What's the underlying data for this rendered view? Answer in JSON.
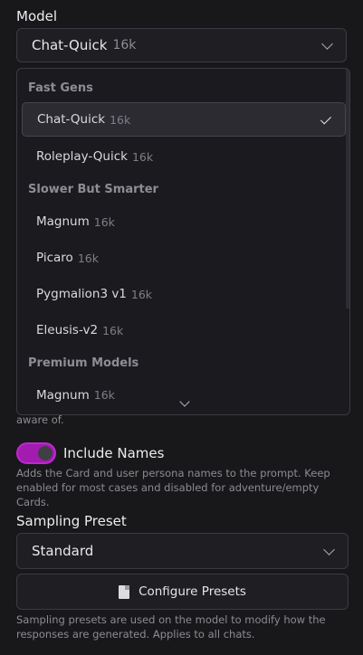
{
  "model": {
    "label": "Model",
    "selected_name": "Chat-Quick",
    "selected_context": "16k"
  },
  "dropdown": {
    "groups": [
      {
        "label": "Fast Gens",
        "options": [
          {
            "name": "Chat-Quick",
            "context": "16k",
            "selected": true
          },
          {
            "name": "Roleplay-Quick",
            "context": "16k",
            "selected": false
          }
        ]
      },
      {
        "label": "Slower But Smarter",
        "options": [
          {
            "name": "Magnum",
            "context": "16k",
            "selected": false
          },
          {
            "name": "Picaro",
            "context": "16k",
            "selected": false
          },
          {
            "name": "Pygmalion3 v1",
            "context": "16k",
            "selected": false
          },
          {
            "name": "Eleusis-v2",
            "context": "16k",
            "selected": false
          }
        ]
      },
      {
        "label": "Premium Models",
        "options": [
          {
            "name": "Magnum",
            "context": "16k",
            "selected": false
          }
        ]
      }
    ]
  },
  "hidden_help_tail": "aware of.",
  "include_names": {
    "label": "Include Names",
    "enabled": true,
    "help": "Adds the Card and user persona names to the prompt. Keep enabled for most cases and disabled for adventure/empty Cards."
  },
  "sampling": {
    "label": "Sampling Preset",
    "selected": "Standard",
    "configure_label": "Configure Presets",
    "help": "Sampling presets are used on the model to modify how the responses are generated. Applies to all chats."
  },
  "icons": {
    "chevron": "chevron-down-icon",
    "check": "check-icon",
    "file": "file-icon"
  },
  "colors": {
    "accent": "#a21caf",
    "background": "#18181b"
  }
}
